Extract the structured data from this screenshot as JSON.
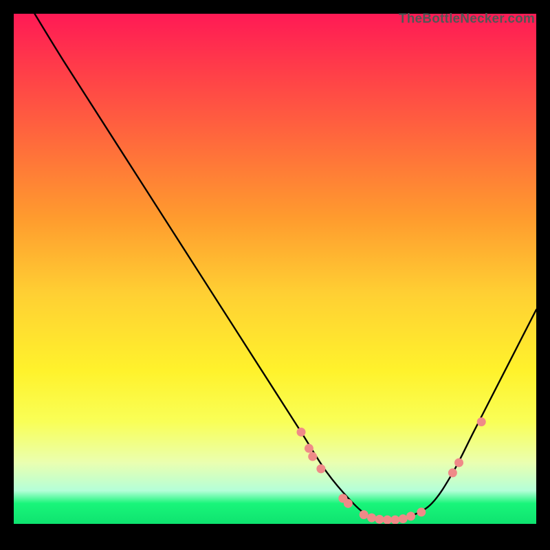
{
  "watermark": "TheBottleNecker.com",
  "chart_data": {
    "type": "line",
    "title": "",
    "xlabel": "",
    "ylabel": "",
    "xlim": [
      0,
      100
    ],
    "ylim": [
      0,
      100
    ],
    "series": [
      {
        "name": "curve",
        "x": [
          4,
          10,
          20,
          30,
          40,
          50,
          55,
          60,
          65,
          68,
          70,
          74,
          76,
          80,
          84,
          88,
          92,
          100
        ],
        "y": [
          100,
          90,
          74,
          58,
          42,
          26,
          18,
          10,
          4,
          1.5,
          0.8,
          0.8,
          1.5,
          4,
          10,
          18,
          26,
          42
        ]
      }
    ],
    "markers": [
      {
        "x": 55.0,
        "y": 18.0
      },
      {
        "x": 56.5,
        "y": 14.8
      },
      {
        "x": 57.2,
        "y": 13.2
      },
      {
        "x": 58.8,
        "y": 10.8
      },
      {
        "x": 63.0,
        "y": 5.0
      },
      {
        "x": 64.0,
        "y": 4.0
      },
      {
        "x": 67.0,
        "y": 1.8
      },
      {
        "x": 68.5,
        "y": 1.2
      },
      {
        "x": 70.0,
        "y": 0.9
      },
      {
        "x": 71.5,
        "y": 0.8
      },
      {
        "x": 73.0,
        "y": 0.8
      },
      {
        "x": 74.5,
        "y": 1.0
      },
      {
        "x": 76.0,
        "y": 1.5
      },
      {
        "x": 78.0,
        "y": 2.3
      },
      {
        "x": 84.0,
        "y": 10.0
      },
      {
        "x": 85.2,
        "y": 12.0
      },
      {
        "x": 89.5,
        "y": 20.0
      }
    ],
    "colors": {
      "line": "#000000",
      "marker": "#ef8a88"
    }
  }
}
